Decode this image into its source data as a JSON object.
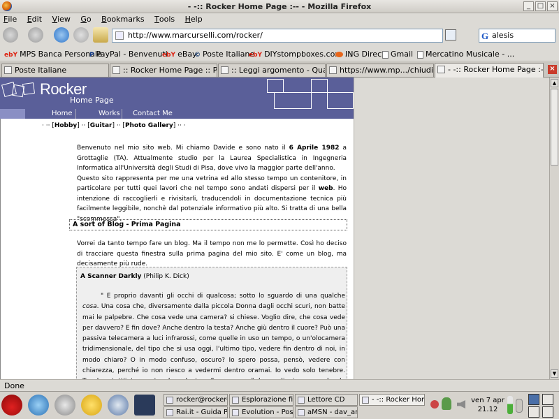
{
  "window": {
    "title": "- -:: Rocker Home Page :-- - Mozilla Firefox",
    "controls": [
      "_",
      "□",
      "×"
    ]
  },
  "menu": {
    "items": [
      {
        "first": "F",
        "rest": "ile"
      },
      {
        "first": "E",
        "rest": "dit"
      },
      {
        "first": "V",
        "rest": "iew"
      },
      {
        "first": "G",
        "rest": "o"
      },
      {
        "first": "B",
        "rest": "ookmarks"
      },
      {
        "first": "T",
        "rest": "ools"
      },
      {
        "first": "H",
        "rest": "elp"
      }
    ]
  },
  "nav": {
    "url": "http://www.marcurselli.com/rocker/",
    "search_value": "alesis",
    "search_engine_letter": "G"
  },
  "bookmarks": [
    {
      "label": "MPS Banca Personale",
      "icon": "ebay-icon",
      "badge": "ebY"
    },
    {
      "label": "PayPal - Benvenuti",
      "icon": "paypal-icon",
      "badge": "P"
    },
    {
      "label": "eBay",
      "icon": "ebay-icon",
      "badge": "ebY"
    },
    {
      "label": "Poste Italiane",
      "icon": "poste-icon",
      "badge": "©"
    },
    {
      "label": "DIYstompboxes.com ...",
      "icon": "ebay-icon",
      "badge": "ebY"
    },
    {
      "label": "ING Direct",
      "icon": "ing-icon",
      "badge": ""
    },
    {
      "label": "Gmail",
      "icon": "page-icon",
      "badge": ""
    },
    {
      "label": "Mercatino Musicale - ...",
      "icon": "page-icon",
      "badge": ""
    }
  ],
  "tabs": [
    {
      "label": "Poste Italiane"
    },
    {
      "label": ":: Rocker Home Page :: Pedal..."
    },
    {
      "label": ":: Leggi argomento - Quale fra..."
    },
    {
      "label": "https://www.mp.../chiudiHB.asp"
    },
    {
      "label": "- -:: Rocker Home Page :-- -"
    }
  ],
  "page": {
    "logo_title": "Rocker",
    "logo_subtitle": "Home Page",
    "nav_links": [
      "Home",
      "Works",
      "Contact Me"
    ],
    "subnav": {
      "pre": "· ·· [",
      "hobby": "Hobby",
      "mid1": "] ·· [",
      "guitar": "Guitar",
      "mid2": "] ·· [",
      "gallery": "Photo Gallery",
      "post": "] ·· ·"
    },
    "intro": {
      "p1a": "Benvenuto nel mio sito web. Mi chiamo Davide e sono nato il ",
      "p1date": "6 Aprile 1982",
      "p1b": " a Grottaglie (TA). Attualmente studio per la Laurea Specialistica in Ingegneria Informatica all'Università degli Studi di Pisa, dove vivo la maggior parte dell'anno.",
      "p2a": "Questo sito rappresenta per me una vetrina ed allo stesso tempo un contenitore, in particolare per tutti quei lavori che nel tempo sono andati dispersi per il ",
      "p2web": "web",
      "p2b": ". Ho intenzione di raccoglierli e rivisitarli, traducendoli in documentazione tecnica più facilmente leggibile, nonchè dal potenziale informativo più alto. Si tratta di una bella \"scommessa\"."
    },
    "blog_heading": "A sort of Blog - Prima Pagina",
    "blog_intro": "Vorrei da tanto tempo fare un blog. Ma il tempo non me lo permette. Così ho deciso di tracciare questa finestra sulla prima pagina del mio sito. E' come un blog, ma decisamente più rude.",
    "scanner": {
      "title": "A Scanner Darkly",
      "author": " (Philip K. Dick)",
      "quote_a": "\" E proprio davanti gli occhi di qualcosa; sotto lo sguardo di una qualche ",
      "quote_cosa": "cosa",
      "quote_b": ". Una cosa che, diversamente dalla piccola Donna dagli occhi scuri, non batte mai le palpebre.  Che cosa vede una camera? si chiese. Voglio dire, che cosa vede per davvero? E fin dove? Anche dentro la testa? Anche giù dentro il cuore? Può una passiva telecamera a luci infrarossi, come quelle in uso un tempo, o un'olocamera tridimensionale, del tipo che si usa oggi, l'ultimo tipo, vedere fin dentro di noi, in modo chiaro? O in modo confuso, oscuro?  Io spero possa, pensò, vedere con chiarezza, perché io non riesco a vedermi dentro oramai. Io vedo solo tenebre. Tenebre tutt'intorno; tenebre dentro. Spero, per il bene di ciascuno, che le olocamere facciano meglio. Perché, pensò, se all'olocamera è dato solo un oscuro vedere, nel modo in cui a me è dato, allora nostra è la maledizione, e ancora"
    }
  },
  "status": {
    "text": "Done"
  },
  "taskbar": {
    "tasks": [
      {
        "label": "rocker@rocker-la"
      },
      {
        "label": "Esplorazione file"
      },
      {
        "label": "Lettore CD"
      },
      {
        "label": "- -:: Rocker Home"
      },
      {
        "label": "Rai.it - Guida Prog"
      },
      {
        "label": "Evolution - Posta"
      },
      {
        "label": "aMSN - dav_ana"
      }
    ],
    "clock_day": "ven  7 apr",
    "clock_time": "21.12"
  },
  "colors": {
    "header_bg": "#5a5f99",
    "nav_light": "#8a8fc4",
    "accent_link": "#1a55c4"
  }
}
